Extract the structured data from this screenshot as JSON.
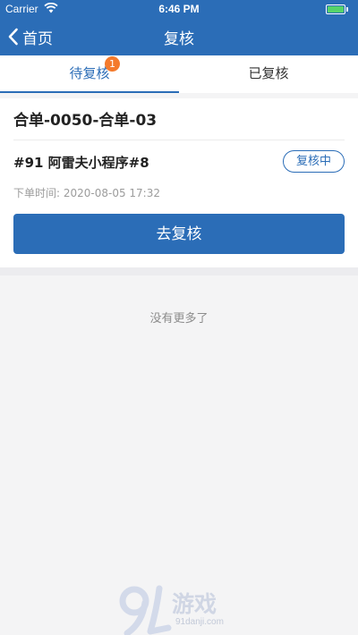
{
  "status_bar": {
    "carrier": "Carrier",
    "time": "6:46 PM",
    "battery_level": 1.0
  },
  "nav": {
    "back_label": "首页",
    "title": "复核"
  },
  "tabs": [
    {
      "label": "待复核",
      "badge": "1",
      "active": true
    },
    {
      "label": "已复核",
      "active": false
    }
  ],
  "order": {
    "title": "合单-0050-合单-03",
    "name": "#91 阿雷夫小程序#8",
    "status": "复核中",
    "time": "下单时间: 2020-08-05 17:32",
    "action_label": "去复核"
  },
  "empty_hint": "没有更多了",
  "watermark": {
    "text": "游戏",
    "url": "91danji.com"
  },
  "colors": {
    "primary": "#2b6db7",
    "badge": "#f47a2c",
    "battery": "#55d36a"
  }
}
